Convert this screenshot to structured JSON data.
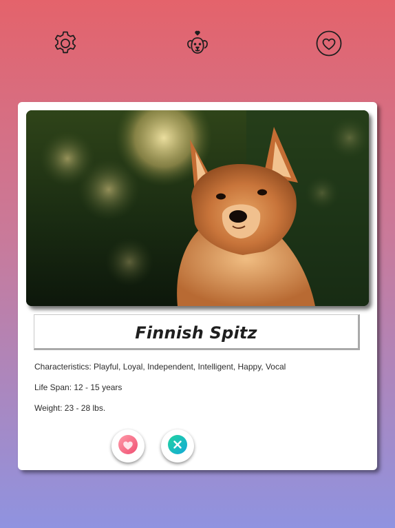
{
  "nav": {
    "settings_icon": "gear-icon",
    "home_icon": "dog-with-heart-icon",
    "favorites_icon": "heart-circle-icon"
  },
  "card": {
    "image_icon": "dog-photo",
    "breed_name": "Finnish Spitz",
    "characteristics": "Characteristics: Playful, Loyal, Independent, Intelligent, Happy, Vocal",
    "life_span": "Life Span: 12 - 15 years",
    "weight": "Weight: 23 - 28 lbs.",
    "like_icon": "heart-icon",
    "dislike_icon": "close-icon"
  },
  "colors": {
    "background_top": "#e4636b",
    "background_bottom": "#8f93e0",
    "like_gradient_start": "#ff9aa8",
    "like_gradient_end": "#ef4f72",
    "dislike_gradient_start": "#22d3a0",
    "dislike_gradient_end": "#14a9d8"
  }
}
